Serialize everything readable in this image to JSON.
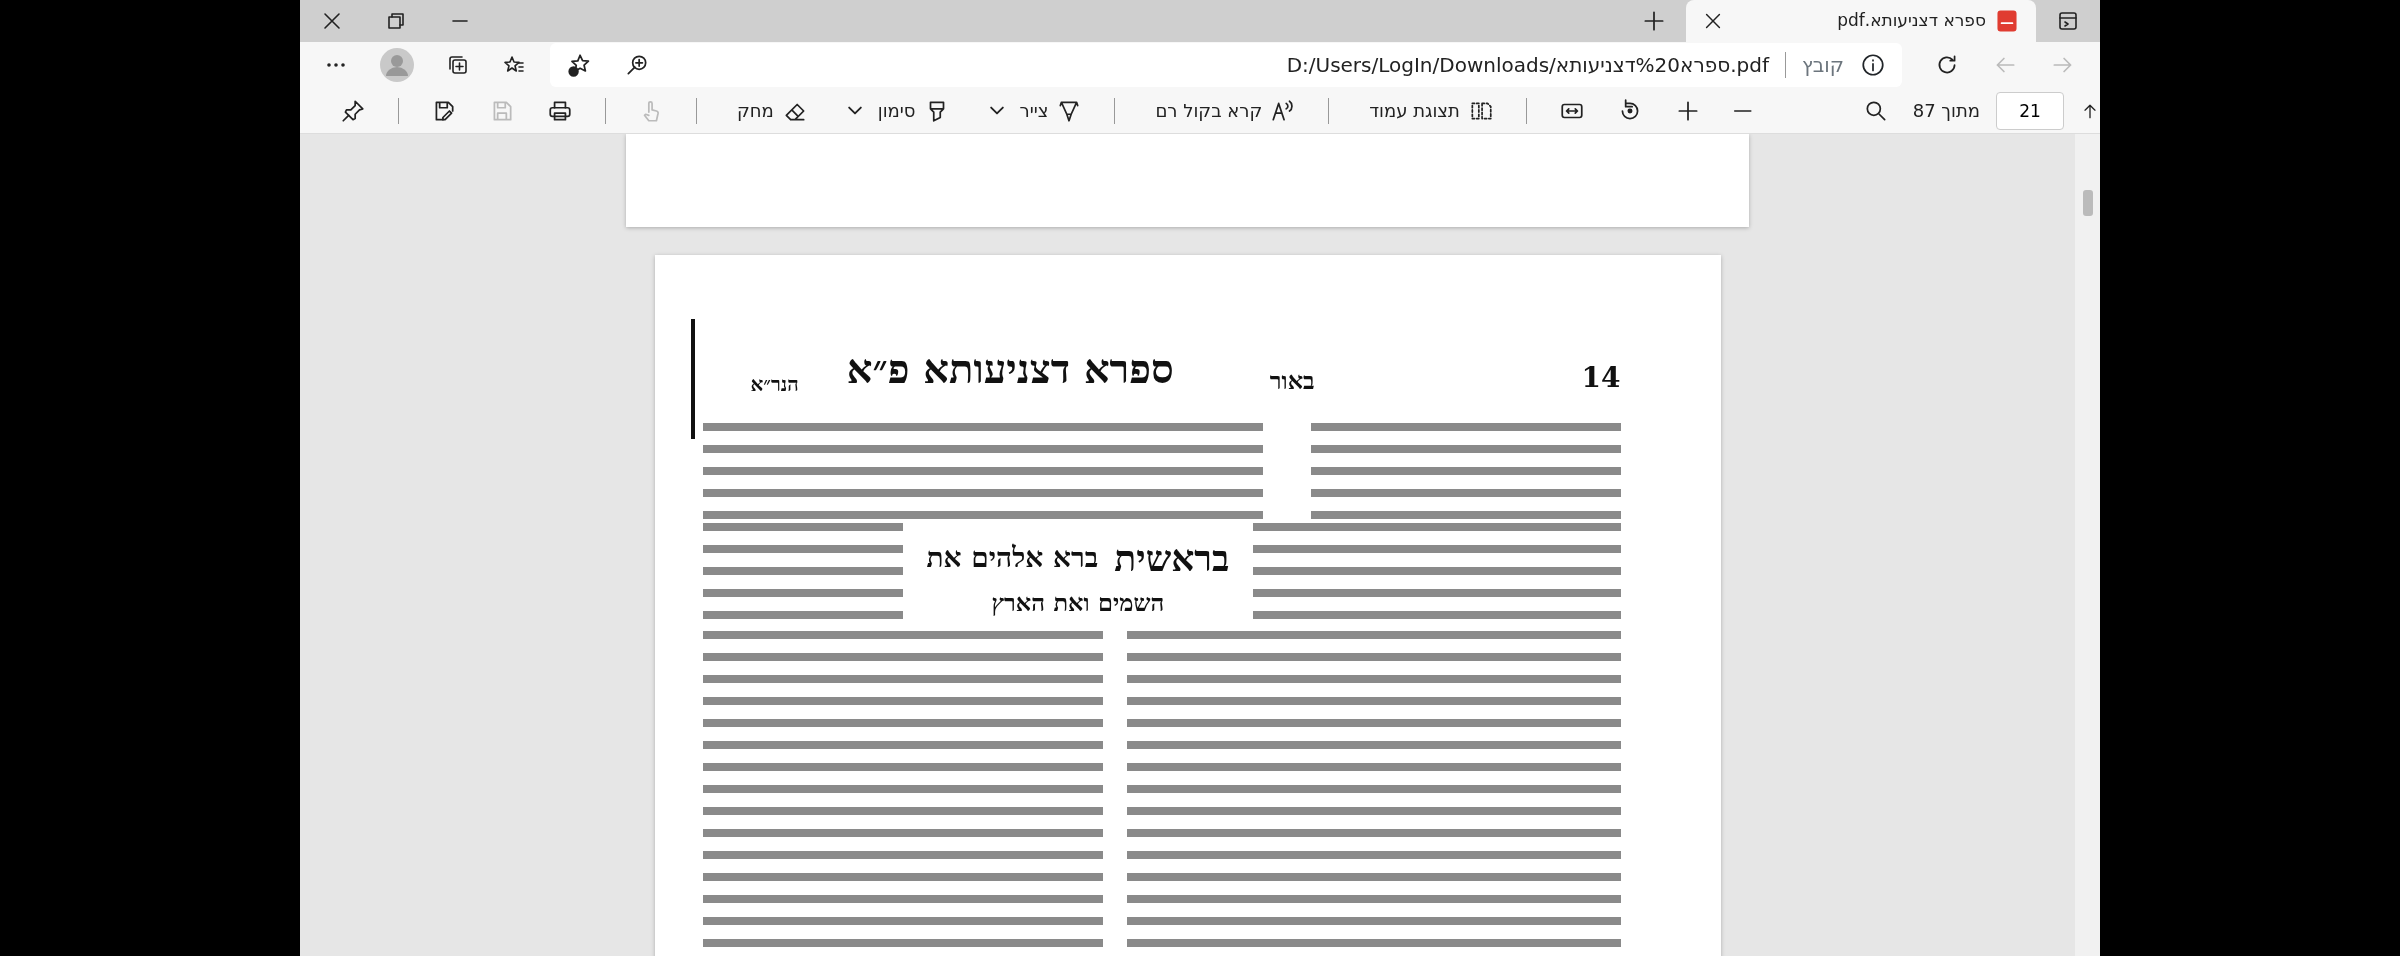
{
  "window_controls": [
    {
      "kind": "close"
    },
    {
      "kind": "restore"
    },
    {
      "kind": "minimize"
    }
  ],
  "tab": {
    "title": "ספרא דצניעותא.pdf",
    "selected": true
  },
  "address_bar": {
    "url": "D:/Users/LogIn/Downloads/ספרא%20דצניעותא.pdf",
    "scheme_label": "קובץ"
  },
  "nav_buttons": [
    {
      "kind": "refresh",
      "disabled": false
    },
    {
      "kind": "back",
      "disabled": true
    },
    {
      "kind": "forward",
      "disabled": true
    }
  ],
  "pdf_toolbar": {
    "tools": [
      {
        "kind": "zoom-out",
        "disabled": false
      },
      {
        "kind": "zoom-in",
        "disabled": false
      },
      {
        "kind": "rotate",
        "disabled": false
      },
      {
        "kind": "fit-width",
        "disabled": false
      },
      {
        "kind": "divider"
      },
      {
        "kind": "page-view",
        "label": "תצוגת עמוד",
        "disabled": false,
        "dropdown": false
      },
      {
        "kind": "divider"
      },
      {
        "kind": "read-aloud",
        "label": "קרא בקול רם",
        "disabled": false,
        "dropdown": false
      },
      {
        "kind": "divider"
      },
      {
        "kind": "draw",
        "label": "צייר",
        "disabled": false,
        "dropdown": true
      },
      {
        "kind": "highlight",
        "label": "סימון",
        "disabled": false,
        "dropdown": true
      },
      {
        "kind": "eraser",
        "label": "מחק",
        "disabled": false,
        "dropdown": false
      },
      {
        "kind": "divider"
      },
      {
        "kind": "touch",
        "disabled": true
      },
      {
        "kind": "divider"
      },
      {
        "kind": "print",
        "disabled": false
      },
      {
        "kind": "save",
        "disabled": true
      },
      {
        "kind": "save-as",
        "disabled": false
      },
      {
        "kind": "divider"
      },
      {
        "kind": "pin",
        "disabled": false
      }
    ],
    "page_total": "מתוך 87",
    "page": "21"
  },
  "document": {
    "page_number": "14",
    "header_right": "באור",
    "title": "ספרא דצניעותא פ״א",
    "header_left": "הנר״א",
    "verse_word": "בראשית",
    "verse_line1": "ברא אלהים את",
    "verse_line2": "השמים ואת הארץ"
  }
}
